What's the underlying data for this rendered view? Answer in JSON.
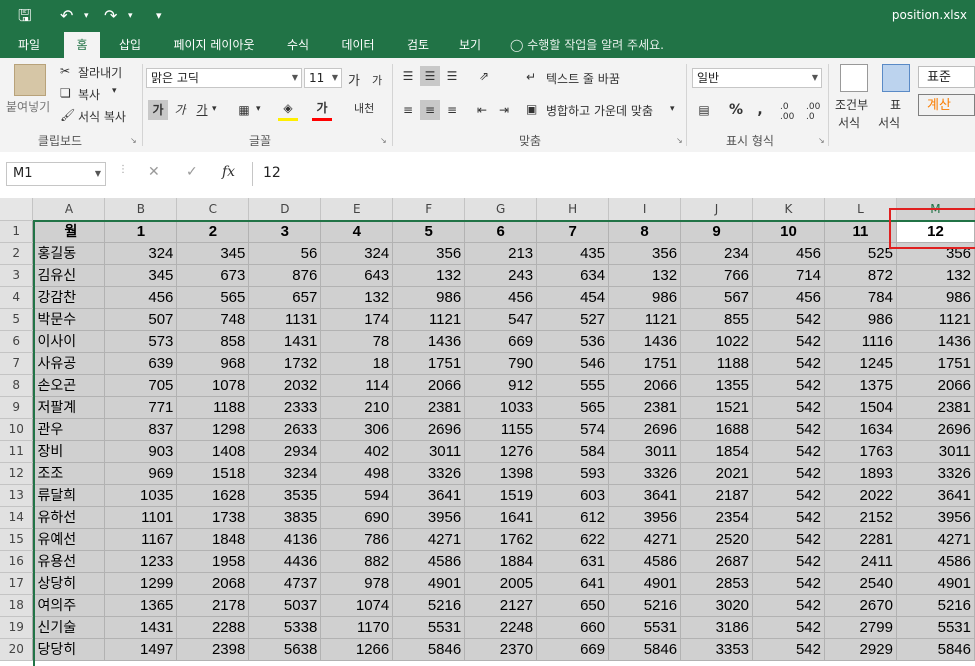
{
  "window": {
    "filename": "position.xlsx"
  },
  "quick_access": {
    "save_icon": "save-icon",
    "undo_icon": "undo-icon",
    "redo_icon": "redo-icon",
    "customize_icon": "customize-icon"
  },
  "tabs": [
    "파일",
    "홈",
    "삽입",
    "페이지 레이아웃",
    "수식",
    "데이터",
    "검토",
    "보기"
  ],
  "active_tab": "홈",
  "tell_me": "수행할 작업을 알려 주세요.",
  "ribbon": {
    "clipboard": {
      "paste": "붙여넣기",
      "cut": "잘라내기",
      "copy": "복사",
      "format_painter": "서식 복사",
      "label": "클립보드"
    },
    "font": {
      "name": "맑은 고딕",
      "size": "11",
      "bold": "가",
      "italic": "가",
      "underline": "가",
      "label": "글꼴",
      "grow": "가",
      "shrink": "가",
      "phonetic": "내천"
    },
    "alignment": {
      "wrap": "텍스트 줄 바꿈",
      "merge": "병합하고 가운데 맞춤",
      "label": "맞춤"
    },
    "number": {
      "format": "일반",
      "percent": "%",
      "comma": ",",
      "label": "표시 형식",
      "inc_decimal": ".0 .00",
      "dec_decimal": ".00 .0"
    },
    "styles": {
      "conditional_line1": "조건부",
      "conditional_line2": "서식",
      "table_line1": "표",
      "table_line2": "서식",
      "normal": "표준",
      "calc": "계산"
    }
  },
  "formula_bar": {
    "name_box": "M1",
    "cancel": "✕",
    "enter": "✓",
    "fx": "fx",
    "value": "12"
  },
  "accent_color": "#217346",
  "columns": [
    "A",
    "B",
    "C",
    "D",
    "E",
    "F",
    "G",
    "H",
    "I",
    "J",
    "K",
    "L",
    "M"
  ],
  "rows": [
    [
      "월",
      "1",
      "2",
      "3",
      "4",
      "5",
      "6",
      "7",
      "8",
      "9",
      "10",
      "11",
      "12"
    ],
    [
      "홍길동",
      "324",
      "345",
      "56",
      "324",
      "356",
      "213",
      "435",
      "356",
      "234",
      "456",
      "525",
      "356"
    ],
    [
      "김유신",
      "345",
      "673",
      "876",
      "643",
      "132",
      "243",
      "634",
      "132",
      "766",
      "714",
      "872",
      "132"
    ],
    [
      "강감찬",
      "456",
      "565",
      "657",
      "132",
      "986",
      "456",
      "454",
      "986",
      "567",
      "456",
      "784",
      "986"
    ],
    [
      "박문수",
      "507",
      "748",
      "1131",
      "174",
      "1121",
      "547",
      "527",
      "1121",
      "855",
      "542",
      "986",
      "1121"
    ],
    [
      "이사이",
      "573",
      "858",
      "1431",
      "78",
      "1436",
      "669",
      "536",
      "1436",
      "1022",
      "542",
      "1116",
      "1436"
    ],
    [
      "사유공",
      "639",
      "968",
      "1732",
      "18",
      "1751",
      "790",
      "546",
      "1751",
      "1188",
      "542",
      "1245",
      "1751"
    ],
    [
      "손오곤",
      "705",
      "1078",
      "2032",
      "114",
      "2066",
      "912",
      "555",
      "2066",
      "1355",
      "542",
      "1375",
      "2066"
    ],
    [
      "저팔계",
      "771",
      "1188",
      "2333",
      "210",
      "2381",
      "1033",
      "565",
      "2381",
      "1521",
      "542",
      "1504",
      "2381"
    ],
    [
      "관우",
      "837",
      "1298",
      "2633",
      "306",
      "2696",
      "1155",
      "574",
      "2696",
      "1688",
      "542",
      "1634",
      "2696"
    ],
    [
      "장비",
      "903",
      "1408",
      "2934",
      "402",
      "3011",
      "1276",
      "584",
      "3011",
      "1854",
      "542",
      "1763",
      "3011"
    ],
    [
      "조조",
      "969",
      "1518",
      "3234",
      "498",
      "3326",
      "1398",
      "593",
      "3326",
      "2021",
      "542",
      "1893",
      "3326"
    ],
    [
      "류달희",
      "1035",
      "1628",
      "3535",
      "594",
      "3641",
      "1519",
      "603",
      "3641",
      "2187",
      "542",
      "2022",
      "3641"
    ],
    [
      "유하선",
      "1101",
      "1738",
      "3835",
      "690",
      "3956",
      "1641",
      "612",
      "3956",
      "2354",
      "542",
      "2152",
      "3956"
    ],
    [
      "유예선",
      "1167",
      "1848",
      "4136",
      "786",
      "4271",
      "1762",
      "622",
      "4271",
      "2520",
      "542",
      "2281",
      "4271"
    ],
    [
      "유용선",
      "1233",
      "1958",
      "4436",
      "882",
      "4586",
      "1884",
      "631",
      "4586",
      "2687",
      "542",
      "2411",
      "4586"
    ],
    [
      "상당히",
      "1299",
      "2068",
      "4737",
      "978",
      "4901",
      "2005",
      "641",
      "4901",
      "2853",
      "542",
      "2540",
      "4901"
    ],
    [
      "여의주",
      "1365",
      "2178",
      "5037",
      "1074",
      "5216",
      "2127",
      "650",
      "5216",
      "3020",
      "542",
      "2670",
      "5216"
    ],
    [
      "신기술",
      "1431",
      "2288",
      "5338",
      "1170",
      "5531",
      "2248",
      "660",
      "5531",
      "3186",
      "542",
      "2799",
      "5531"
    ],
    [
      "당당히",
      "1497",
      "2398",
      "5638",
      "1266",
      "5846",
      "2370",
      "669",
      "5846",
      "3353",
      "542",
      "2929",
      "5846"
    ]
  ]
}
